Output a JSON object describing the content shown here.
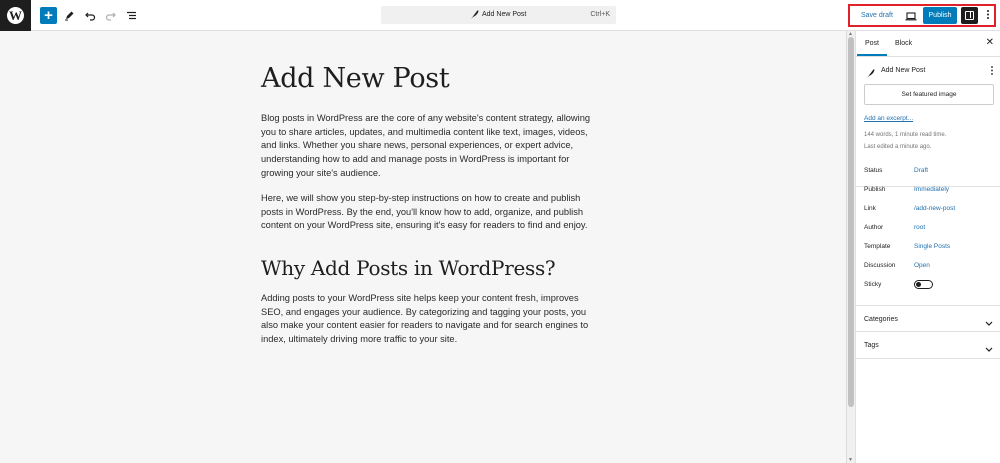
{
  "header": {
    "document_title": "Add New Post",
    "shortcut": "Ctrl+K",
    "save_draft": "Save draft",
    "publish": "Publish",
    "add_symbol": "+"
  },
  "editor": {
    "title": "Add New Post",
    "paragraphs": [
      "Blog posts in WordPress are the core of any website's content strategy, allowing you to share articles, updates, and multimedia content like text, images, videos, and links. Whether you share news, personal experiences, or expert advice, understanding how to add and manage posts in WordPress is important for growing your site's audience.",
      "Here, we will show you step-by-step instructions on how to create and publish posts in WordPress. By the end, you'll know how to add, organize, and publish content on your WordPress site, ensuring it's easy for readers to find and enjoy."
    ],
    "heading2": "Why Add Posts in WordPress?",
    "paragraph3": "Adding posts to your WordPress site helps keep your content fresh, improves SEO, and engages your audience. By categorizing and tagging your posts, you also make your content easier for readers to navigate and for search engines to index, ultimately driving more traffic to your site."
  },
  "sidebar": {
    "tabs": [
      "Post",
      "Block"
    ],
    "close": "✕",
    "post_title": "Add New Post",
    "featured_image": "Set featured image",
    "excerpt_link": "Add an excerpt...",
    "meta_words": "144 words, 1 minute read time.",
    "meta_edited": "Last edited a minute ago.",
    "rows": [
      {
        "label": "Status",
        "value": "Draft"
      },
      {
        "label": "Publish",
        "value": "Immediately"
      },
      {
        "label": "Link",
        "value": "/add-new-post"
      },
      {
        "label": "Author",
        "value": "root"
      },
      {
        "label": "Template",
        "value": "Single Posts"
      },
      {
        "label": "Discussion",
        "value": "Open"
      }
    ],
    "sticky_label": "Sticky",
    "sticky_on": false,
    "panels": [
      "Categories",
      "Tags"
    ]
  },
  "colors": {
    "accent": "#007cba",
    "link": "#2271b1",
    "highlight_border": "#e0212a"
  },
  "icons": {
    "logo": "wordpress-logo",
    "add": "plus-icon",
    "tools": "pencil-icon",
    "undo": "undo-icon",
    "redo": "redo-icon",
    "list_view": "list-view-icon",
    "feather": "feather-icon",
    "preview": "laptop-icon",
    "settings": "sidebar-toggle-icon",
    "more": "more-vertical-icon",
    "chevron": "chevron-down-icon"
  }
}
